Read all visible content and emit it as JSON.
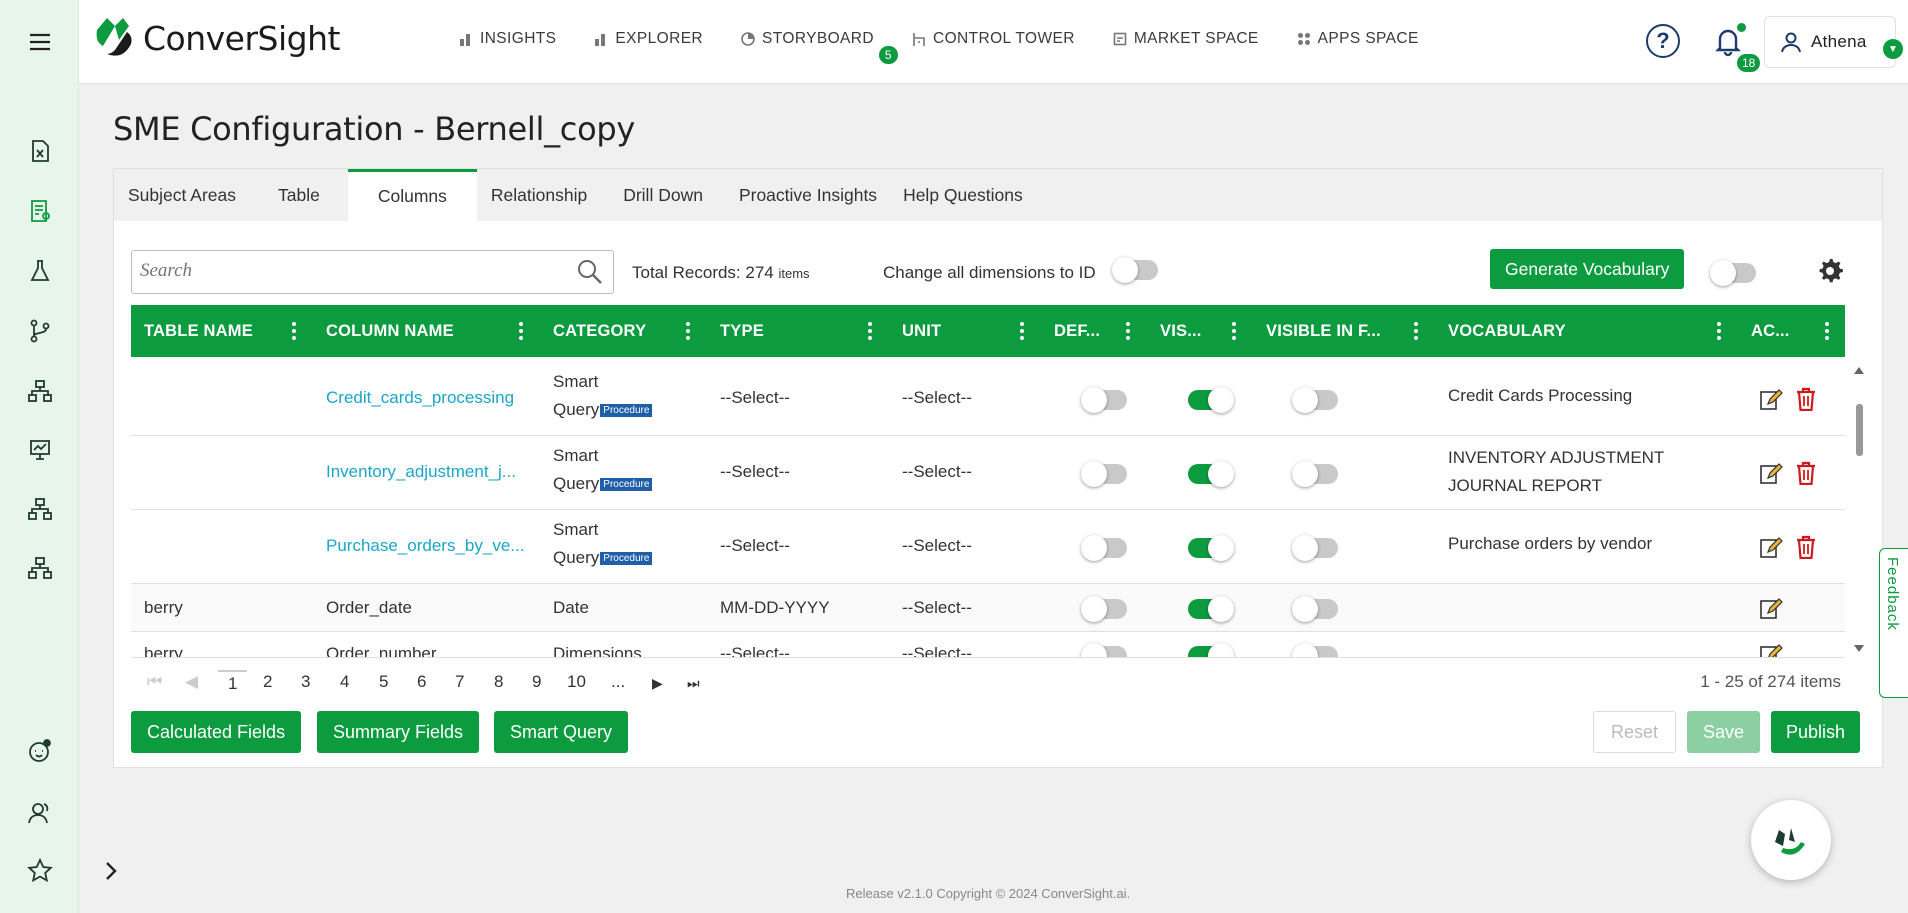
{
  "app": {
    "brand": "ConverSight",
    "nav": [
      {
        "label": "INSIGHTS",
        "icon": "bar-chart-icon"
      },
      {
        "label": "EXPLORER",
        "icon": "bar-chart-icon"
      },
      {
        "label": "STORYBOARD",
        "icon": "pie-chart-icon",
        "badge": "5"
      },
      {
        "label": "CONTROL TOWER",
        "icon": "tower-icon"
      },
      {
        "label": "MARKET SPACE",
        "icon": "store-icon"
      },
      {
        "label": "APPS SPACE",
        "icon": "apps-grid-icon"
      }
    ],
    "notifications_count": "18",
    "user_name": "Athena"
  },
  "sidebar": {
    "items": [
      {
        "icon": "excel-file-icon"
      },
      {
        "icon": "document-user-icon",
        "active": true
      },
      {
        "icon": "flask-icon"
      },
      {
        "icon": "branch-icon"
      },
      {
        "icon": "hierarchy-icon"
      },
      {
        "icon": "presentation-chart-icon"
      },
      {
        "icon": "hierarchy-icon"
      },
      {
        "icon": "hierarchy-icon"
      },
      {
        "icon": "assistant-face-icon"
      },
      {
        "icon": "users-icon"
      },
      {
        "icon": "star-icon"
      }
    ]
  },
  "page": {
    "title": "SME Configuration - Bernell_copy",
    "tabs": [
      "Subject Areas",
      "Table",
      "Columns",
      "Relationship",
      "Drill Down",
      "Proactive Insights",
      "Help Questions"
    ],
    "active_tab": "Columns"
  },
  "toolbar": {
    "search_placeholder": "Search",
    "total_label": "Total Records: 274",
    "total_unit": "items",
    "change_dims_label": "Change all dimensions to ID",
    "generate_vocab_label": "Generate Vocabulary"
  },
  "grid": {
    "columns": [
      "TABLE NAME",
      "COLUMN NAME",
      "CATEGORY",
      "TYPE",
      "UNIT",
      "DEF...",
      "VIS...",
      "VISIBLE IN F...",
      "VOCABULARY",
      "AC..."
    ],
    "rows": [
      {
        "table": "",
        "column": "Credit_cards_processing",
        "cat1": "Smart",
        "cat2": "Query",
        "tag": "Procedure",
        "type": "--Select--",
        "unit": "--Select--",
        "def": false,
        "vis": true,
        "visf": false,
        "vocab1": "Credit Cards Processing",
        "vocab2": "",
        "deletable": true
      },
      {
        "table": "",
        "column": "Inventory_adjustment_j...",
        "cat1": "Smart",
        "cat2": "Query",
        "tag": "Procedure",
        "type": "--Select--",
        "unit": "--Select--",
        "def": false,
        "vis": true,
        "visf": false,
        "vocab1": "INVENTORY ADJUSTMENT",
        "vocab2": "JOURNAL REPORT",
        "deletable": true
      },
      {
        "table": "",
        "column": "Purchase_orders_by_ve...",
        "cat1": "Smart",
        "cat2": "Query",
        "tag": "Procedure",
        "type": "--Select--",
        "unit": "--Select--",
        "def": false,
        "vis": true,
        "visf": false,
        "vocab1": "Purchase orders by vendor",
        "vocab2": "",
        "deletable": true
      },
      {
        "table": "berry",
        "column": "Order_date",
        "cat1": "Date",
        "cat2": "",
        "tag": "",
        "type": "MM-DD-YYYY",
        "unit": "--Select--",
        "def": false,
        "vis": true,
        "visf": false,
        "vocab1": "",
        "vocab2": "",
        "deletable": false
      },
      {
        "table": "berry",
        "column": "Order_number",
        "cat1": "Dimensions",
        "cat2": "",
        "tag": "",
        "type": "--Select--",
        "unit": "--Select--",
        "def": false,
        "vis": true,
        "visf": false,
        "vocab1": "",
        "vocab2": "",
        "deletable": false
      }
    ]
  },
  "pager": {
    "pages": [
      "1",
      "2",
      "3",
      "4",
      "5",
      "6",
      "7",
      "8",
      "9",
      "10",
      "..."
    ],
    "current": "1",
    "info": "1 - 25 of 274 items"
  },
  "actions": {
    "calculated_fields": "Calculated Fields",
    "summary_fields": "Summary Fields",
    "smart_query": "Smart Query",
    "reset": "Reset",
    "save": "Save",
    "publish": "Publish"
  },
  "footer": "Release v2.1.0 Copyright © 2024 ConverSight.ai.",
  "feedback_label": "Feedback",
  "colors": {
    "accent": "#0d9b3f",
    "link": "#1aa6c9",
    "danger": "#d0191c",
    "procedure_tag": "#1e5fa8"
  }
}
